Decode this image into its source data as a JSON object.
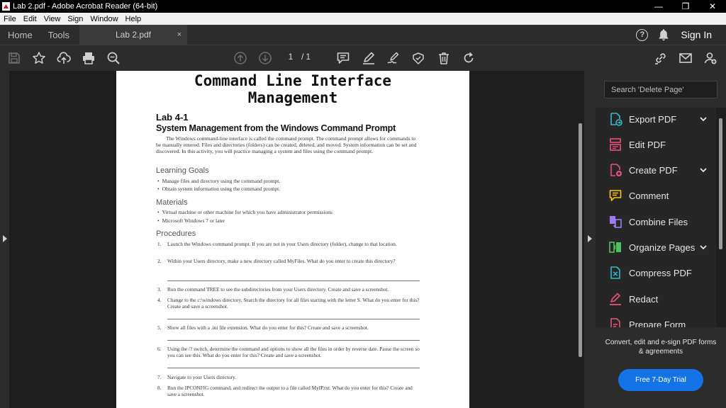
{
  "window": {
    "title": "Lab 2.pdf - Adobe Acrobat Reader (64-bit)",
    "minimize": "—",
    "maximize": "❐",
    "close": "✕"
  },
  "menu": [
    "File",
    "Edit",
    "View",
    "Sign",
    "Window",
    "Help"
  ],
  "tabs": {
    "home": "Home",
    "tools": "Tools",
    "document": "Lab 2.pdf",
    "close": "×",
    "help": "?",
    "sign_in": "Sign In"
  },
  "toolbar": {
    "current_page": "1",
    "separator": "/",
    "total_pages": "1"
  },
  "page": {
    "title_line1": "Command Line Interface",
    "title_line2": "Management",
    "lab_number": "Lab 4-1",
    "lab_title": "System Management from the Windows Command Prompt",
    "intro": "The Windows command-line interface is called the command prompt. The command prompt allows for commands to be manually entered. Files and directories (folders) can be created, deleted, and moved. System information can be set and discovered. In this activity, you will practice managing a system and files using the command prompt.",
    "learning_goals_heading": "Learning Goals",
    "learning_goals": [
      "Manage files and directory using the command prompt.",
      "Obtain system information using the command prompt."
    ],
    "materials_heading": "Materials",
    "materials": [
      "Virtual machine or other machine for which you have administrator permissions",
      "Microsoft Windows 7 or later"
    ],
    "procedures_heading": "Procedures",
    "procedures": [
      {
        "n": "1.",
        "text": "Launch the Windows command prompt. If you are not in your Users directory (folder), change to that location."
      },
      {
        "n": "2.",
        "text": "Within your Users directory, make a new directory called MyFiles. What do you enter to create this directory?"
      },
      {
        "n": "3.",
        "text": "Run the command TREE to see the subdirectories from your Users directory. Create and save a screenshot."
      },
      {
        "n": "4.",
        "text": "Change to the c:\\windows directory. Search the directory for all files starting with the letter S. What do you enter for this? Create and save a screenshot."
      },
      {
        "n": "5.",
        "text": "Show all files with a .ini file extension. What do you enter for this? Create and save a screenshot."
      },
      {
        "n": "6.",
        "text": "Using the /? switch, determine the command and options to show all the files in order by reverse date. Pause the screen so you can see this. What do you enter for this? Create and save a screenshot."
      },
      {
        "n": "7.",
        "text": "Navigate to your Users directory."
      },
      {
        "n": "8.",
        "text": "Run the IPCONFIG command, and redirect the output to a file called MyIP.txt. What do you enter for this? Create and save a screenshot."
      }
    ]
  },
  "right_panel": {
    "search_placeholder": "Search 'Delete Page'",
    "tools": [
      {
        "label": "Export PDF",
        "icon": "export-pdf-icon",
        "color": "#32bcc8",
        "expandable": true
      },
      {
        "label": "Edit PDF",
        "icon": "edit-pdf-icon",
        "color": "#e8517a",
        "expandable": false
      },
      {
        "label": "Create PDF",
        "icon": "create-pdf-icon",
        "color": "#e8517a",
        "expandable": true
      },
      {
        "label": "Comment",
        "icon": "comment-icon",
        "color": "#f5c518",
        "expandable": false
      },
      {
        "label": "Combine Files",
        "icon": "combine-files-icon",
        "color": "#9b7cf0",
        "expandable": false
      },
      {
        "label": "Organize Pages",
        "icon": "organize-pages-icon",
        "color": "#4bc35c",
        "expandable": true
      },
      {
        "label": "Compress PDF",
        "icon": "compress-pdf-icon",
        "color": "#32bcc8",
        "expandable": false
      },
      {
        "label": "Redact",
        "icon": "redact-icon",
        "color": "#e8517a",
        "expandable": false
      },
      {
        "label": "Prepare Form",
        "icon": "prepare-form-icon",
        "color": "#e8517a",
        "expandable": false
      }
    ],
    "promo_text": "Convert, edit and e-sign PDF forms & agreements",
    "trial_button": "Free 7-Day Trial"
  }
}
